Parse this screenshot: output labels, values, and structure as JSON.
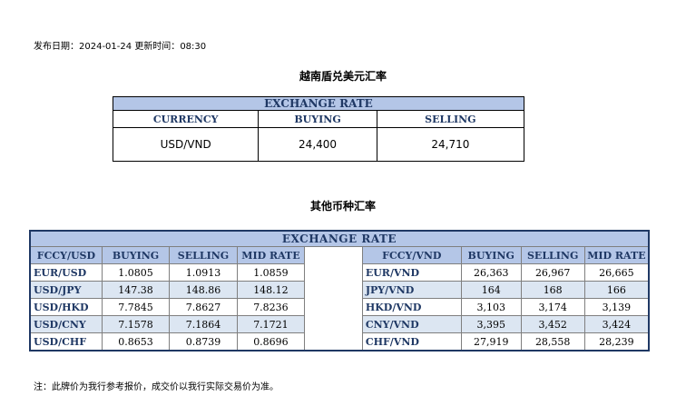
{
  "meta": {
    "publish_date_label": "发布日期：",
    "publish_date": "2024-01-24",
    "update_time_label": "更新时间：",
    "update_time": "08:30"
  },
  "usd_section": {
    "title": "越南盾兑美元汇率",
    "caption": "EXCHANGE RATE",
    "headers": [
      "CURRENCY",
      "BUYING",
      "SELLING"
    ],
    "row": {
      "currency": "USD/VND",
      "buying": "24,400",
      "selling": "24,710"
    }
  },
  "other_section": {
    "title": "其他币种汇率",
    "caption": "EXCHANGE  RATE",
    "left_headers": [
      "FCCY/USD",
      "BUYING",
      "SELLING",
      "MID RATE"
    ],
    "right_headers": [
      "FCCY/VND",
      "BUYING",
      "SELLING",
      "MID RATE"
    ],
    "rows": [
      {
        "l_pair": "EUR/USD",
        "l_buy": "1.0805",
        "l_sell": "1.0913",
        "l_mid": "1.0859",
        "r_pair": "EUR/VND",
        "r_buy": "26,363",
        "r_sell": "26,967",
        "r_mid": "26,665"
      },
      {
        "l_pair": "USD/JPY",
        "l_buy": "147.38",
        "l_sell": "148.86",
        "l_mid": "148.12",
        "r_pair": "JPY/VND",
        "r_buy": "164",
        "r_sell": "168",
        "r_mid": "166"
      },
      {
        "l_pair": "USD/HKD",
        "l_buy": "7.7845",
        "l_sell": "7.8627",
        "l_mid": "7.8236",
        "r_pair": "HKD/VND",
        "r_buy": "3,103",
        "r_sell": "3,174",
        "r_mid": "3,139"
      },
      {
        "l_pair": "USD/CNY",
        "l_buy": "7.1578",
        "l_sell": "7.1864",
        "l_mid": "7.1721",
        "r_pair": "CNY/VND",
        "r_buy": "3,395",
        "r_sell": "3,452",
        "r_mid": "3,424"
      },
      {
        "l_pair": "USD/CHF",
        "l_buy": "0.8653",
        "l_sell": "0.8739",
        "l_mid": "0.8696",
        "r_pair": "CHF/VND",
        "r_buy": "27,919",
        "r_sell": "28,558",
        "r_mid": "28,239"
      }
    ]
  },
  "footnote": "注：此牌价为我行参考报价，成交价以我行实际交易价为准。",
  "colors": {
    "header_fill": "#b4c6e7",
    "stripe_fill": "#dce6f2",
    "header_text": "#1f3864"
  }
}
